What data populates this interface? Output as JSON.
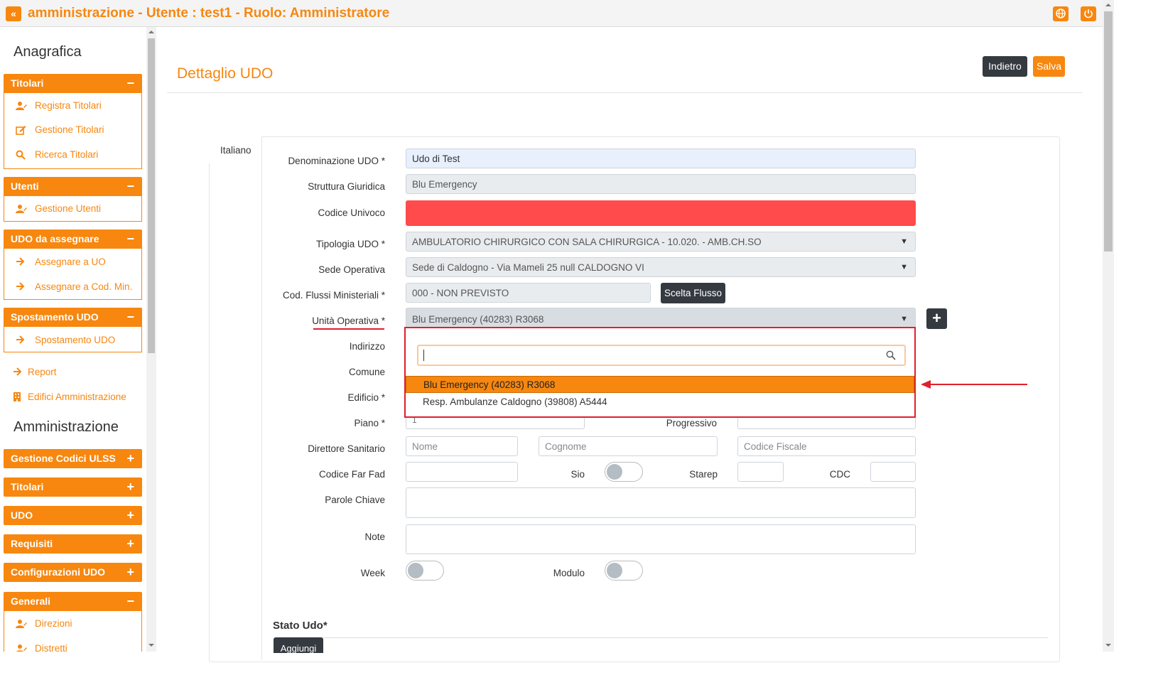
{
  "header": {
    "toggle_icon": "«",
    "title": "amministrazione - Utente : test1 - Ruolo: Amministratore",
    "accent_color": "#f7870f"
  },
  "sidebar": {
    "section_anagrafica": "Anagrafica",
    "titolari": {
      "label": "Titolari",
      "sign": "−",
      "items": [
        "Registra Titolari",
        "Gestione Titolari",
        "Ricerca Titolari"
      ]
    },
    "utenti": {
      "label": "Utenti",
      "sign": "−",
      "items": [
        "Gestione Utenti"
      ]
    },
    "udo_da_assegnare": {
      "label": "UDO da assegnare",
      "sign": "−",
      "items": [
        "Assegnare a UO",
        "Assegnare a Cod. Min."
      ]
    },
    "spostamento_udo": {
      "label": "Spostamento UDO",
      "sign": "−",
      "items": [
        "Spostamento UDO"
      ]
    },
    "flat_items": [
      "Report",
      "Edifici Amministrazione"
    ],
    "section_amministrazione": "Amministrazione",
    "collapsed_panels": [
      {
        "label": "Gestione Codici ULSS",
        "sign": "+"
      },
      {
        "label": "Titolari",
        "sign": "+"
      },
      {
        "label": "UDO",
        "sign": "+"
      },
      {
        "label": "Requisiti",
        "sign": "+"
      },
      {
        "label": "Configurazioni UDO",
        "sign": "+"
      }
    ],
    "generali": {
      "label": "Generali",
      "sign": "−",
      "items": [
        "Direzioni",
        "Distretti"
      ]
    }
  },
  "main": {
    "title": "Dettaglio UDO",
    "back_label": "Indietro",
    "save_label": "Salva",
    "tab_label": "Italiano",
    "form": {
      "denominazione": {
        "label": "Denominazione UDO *",
        "value": "Udo di Test"
      },
      "struttura": {
        "label": "Struttura Giuridica",
        "value": "Blu Emergency"
      },
      "codice_univoco": {
        "label": "Codice Univoco",
        "value": ""
      },
      "tipologia": {
        "label": "Tipologia UDO *",
        "value": "AMBULATORIO CHIRURGICO CON SALA CHIRURGICA - 10.020. - AMB.CH.SO"
      },
      "sede": {
        "label": "Sede Operativa",
        "value": "Sede di Caldogno - Via Mameli 25 null CALDOGNO VI"
      },
      "flussi": {
        "label": "Cod. Flussi Ministeriali *",
        "value": "000 - NON PREVISTO",
        "button": "Scelta Flusso"
      },
      "unita_operativa": {
        "label": "Unità Operativa *",
        "value": "Blu Emergency (40283) R3068"
      },
      "indirizzo": {
        "label": "Indirizzo"
      },
      "comune": {
        "label": "Comune"
      },
      "edificio": {
        "label": "Edificio *"
      },
      "piano": {
        "label": "Piano *",
        "value": "1"
      },
      "progressivo": {
        "label": "Progressivo"
      },
      "direttore": {
        "label": "Direttore Sanitario",
        "nome_placeholder": "Nome",
        "cognome_placeholder": "Cognome",
        "cf_placeholder": "Codice Fiscale"
      },
      "codice_far_fad": {
        "label": "Codice Far Fad"
      },
      "sio": {
        "label": "Sio"
      },
      "starep": {
        "label": "Starep"
      },
      "cdc": {
        "label": "CDC"
      },
      "parole_chiave": {
        "label": "Parole Chiave"
      },
      "note": {
        "label": "Note"
      },
      "week": {
        "label": "Week"
      },
      "modulo": {
        "label": "Modulo"
      }
    },
    "dropdown": {
      "search_value": "",
      "options": [
        "Blu Emergency (40283) R3068",
        "Resp. Ambulanze Caldogno (39808) A5444"
      ],
      "selected_index": 0
    },
    "stato_title": "Stato Udo*",
    "add_label": "Aggiungi"
  }
}
